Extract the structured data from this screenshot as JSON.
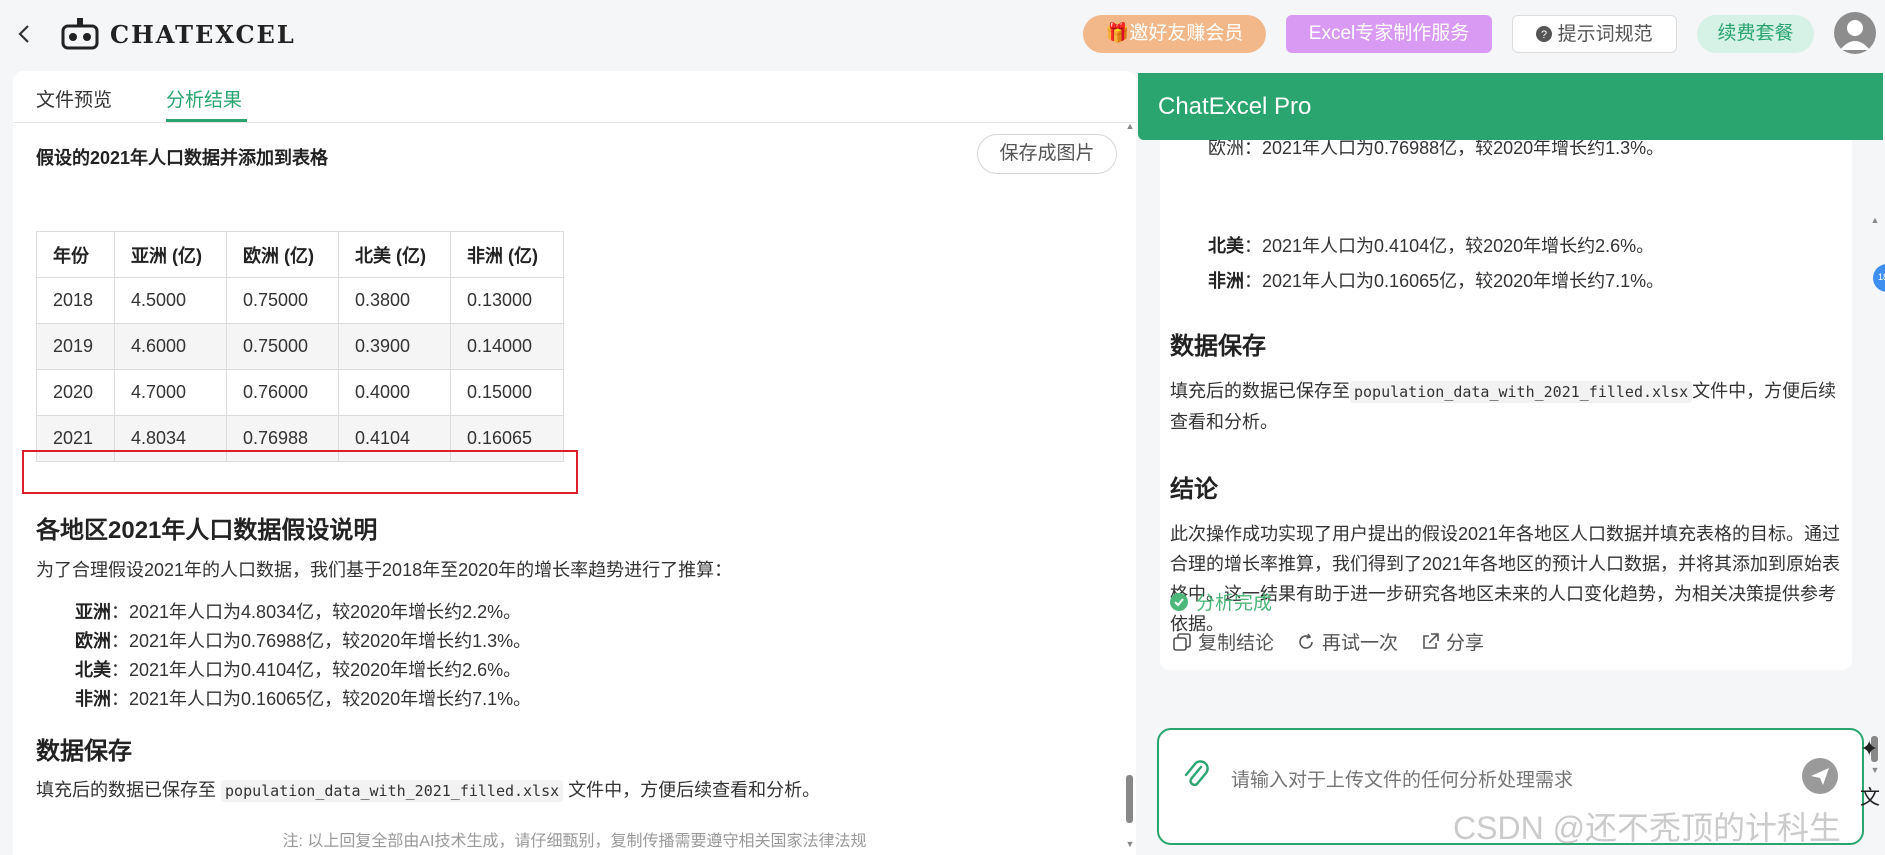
{
  "topbar": {
    "back_icon": "chevron-left-icon",
    "logo_text": "ChatExcel",
    "invite_label": "邀好友赚会员",
    "expert_label": "Excel专家制作服务",
    "prompt_label": "提示词规范",
    "renew_label": "续费套餐"
  },
  "left": {
    "tabs": [
      "文件预览",
      "分析结果"
    ],
    "active_tab": "分析结果",
    "save_image_label": "保存成图片",
    "table_title": "假设的2021年人口数据并添加到表格",
    "table": {
      "headers": [
        "年份",
        "亚洲 (亿)",
        "欧洲 (亿)",
        "北美 (亿)",
        "非洲 (亿)"
      ],
      "rows": [
        [
          "2018",
          "4.5000",
          "0.75000",
          "0.3800",
          "0.13000"
        ],
        [
          "2019",
          "4.6000",
          "0.75000",
          "0.3900",
          "0.14000"
        ],
        [
          "2020",
          "4.7000",
          "0.76000",
          "0.4000",
          "0.15000"
        ],
        [
          "2021",
          "4.8034",
          "0.76988",
          "0.4104",
          "0.16065"
        ]
      ]
    },
    "assumption_heading": "各地区2021年人口数据假设说明",
    "assumption_intro": "为了合理假设2021年的人口数据，我们基于2018年至2020年的增长率趋势进行了推算：",
    "bullets": [
      {
        "region": "亚洲",
        "text": "：2021年人口为4.8034亿，较2020年增长约2.2%。"
      },
      {
        "region": "欧洲",
        "text": "：2021年人口为0.76988亿，较2020年增长约1.3%。"
      },
      {
        "region": "北美",
        "text": "：2021年人口为0.4104亿，较2020年增长约2.6%。"
      },
      {
        "region": "非洲",
        "text": "：2021年人口为0.16065亿，较2020年增长约7.1%。"
      }
    ],
    "save_heading": "数据保存",
    "save_text_before": "填充后的数据已保存至",
    "save_filename": "population_data_with_2021_filled.xlsx",
    "save_text_after": "文件中，方便后续查看和分析。",
    "footnote": "注: 以上回复全部由AI技术生成，请仔细甄别，复制传播需要遵守相关国家法律法规"
  },
  "right": {
    "title": "ChatExcel Pro",
    "partial_line": "欧洲：2021年人口为0.76988亿，较2020年增长约1.3%。",
    "bullets": [
      {
        "region": "北美",
        "text": "：2021年人口为0.4104亿，较2020年增长约2.6%。"
      },
      {
        "region": "非洲",
        "text": "：2021年人口为0.16065亿，较2020年增长约7.1%。"
      }
    ],
    "save_heading": "数据保存",
    "save_text_before": "填充后的数据已保存至",
    "save_filename": "population_data_with_2021_filled.xlsx",
    "save_text_after": "文件中，方便后续查看和分析。",
    "conclusion_heading": "结论",
    "conclusion_text": "此次操作成功实现了用户提出的假设2021年各地区人口数据并填充表格的目标。通过合理的增长率推算，我们得到了2021年各地区的预计人口数据，并将其添加到原始表格中。这一结果有助于进一步研究各地区未来的人口变化趋势，为相关决策提供参考依据。",
    "status": "分析完成",
    "actions": [
      "复制结论",
      "再试一次",
      "分享"
    ],
    "input_placeholder": "请输入对于上传文件的任何分析处理需求",
    "side_badge": "18"
  },
  "watermark": "CSDN @还不秃顶的计科生",
  "colors": {
    "brand_green": "#2aa56f",
    "highlight_red": "#dd1f29"
  }
}
